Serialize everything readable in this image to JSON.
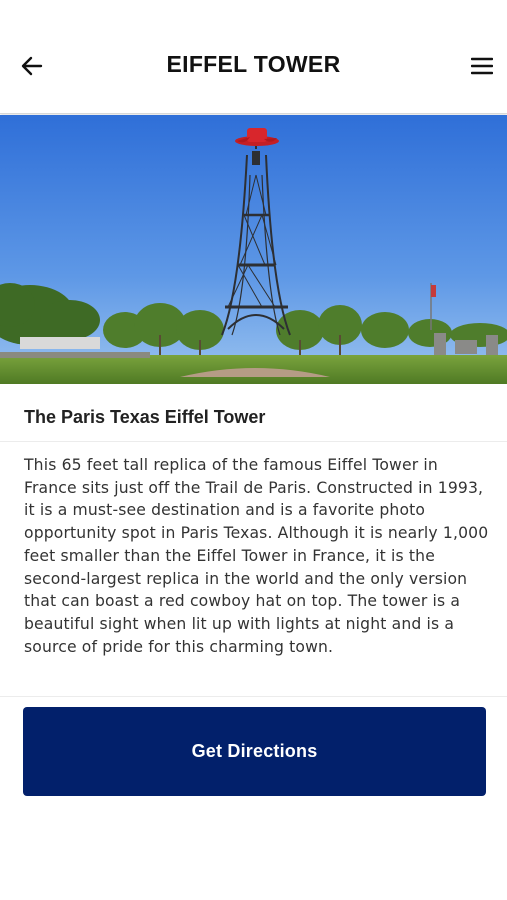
{
  "header": {
    "title": "EIFFEL TOWER",
    "back_icon": "arrow-left-icon",
    "menu_icon": "hamburger-menu-icon"
  },
  "hero": {
    "image": "eiffel-tower-replica-photo"
  },
  "content": {
    "title": "The Paris Texas Eiffel Tower",
    "description": "This 65 feet tall replica of the famous Eiffel Tower in France sits just off the Trail de Paris. Constructed in 1993, it is a must-see destination and is a favorite photo opportunity spot in Paris Texas. Although it is nearly 1,000 feet smaller than the Eiffel Tower in France, it is the second-largest replica in the world and the only version that can boast a red cowboy hat on top. The tower is a beautiful sight when lit up with lights at night and is a source of pride for this charming town."
  },
  "actions": {
    "directions_label": "Get Directions"
  },
  "colors": {
    "primary": "#02206b",
    "sky": "#3f7ed8",
    "hat": "#d8262c"
  }
}
